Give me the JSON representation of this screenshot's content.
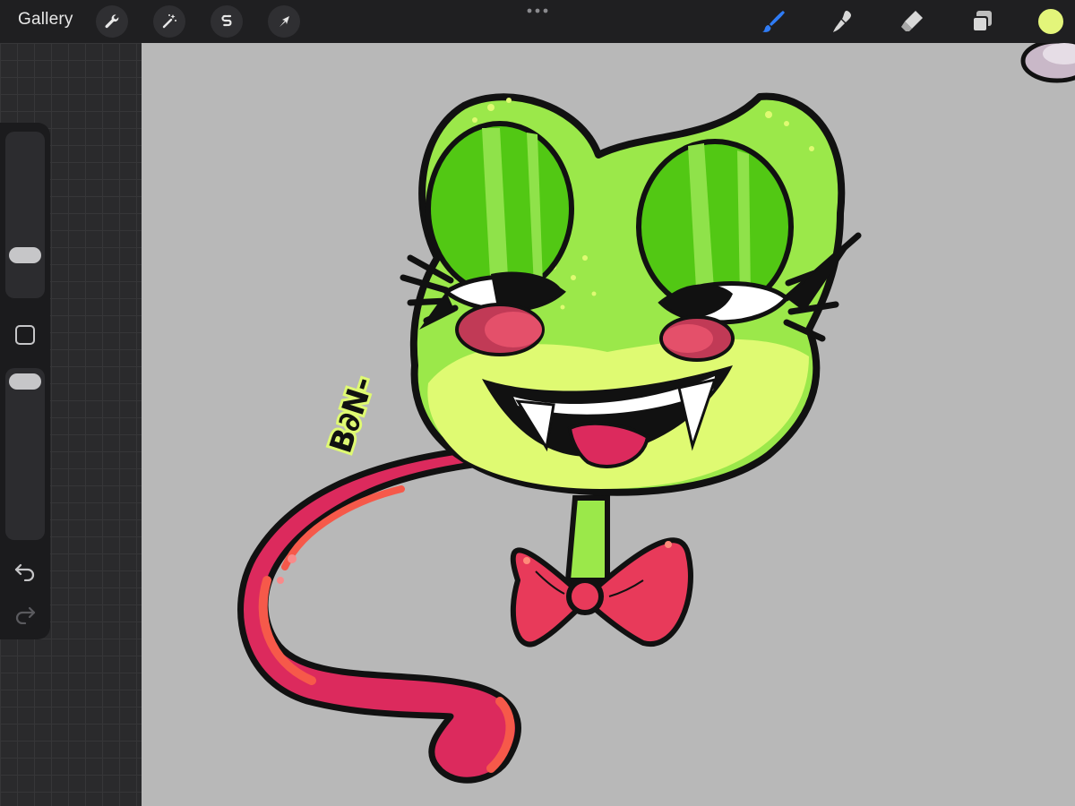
{
  "toolbar": {
    "gallery_label": "Gallery",
    "left_tools": [
      "wrench-icon",
      "magic-wand-icon",
      "selection-icon",
      "transform-arrow-icon"
    ],
    "right_tools": [
      "brush-icon",
      "smudge-icon",
      "eraser-icon",
      "layers-icon"
    ],
    "active_tool": "brush-icon",
    "current_color": "#e3f57a",
    "accent_color": "#2f7cf6"
  },
  "sidebar": {
    "tools": [
      "brush-size-slider",
      "modify-button",
      "opacity-slider",
      "undo-icon",
      "redo-icon"
    ]
  },
  "canvas": {
    "background_color": "#b8b8b8",
    "signature_text": "B∂N-"
  }
}
